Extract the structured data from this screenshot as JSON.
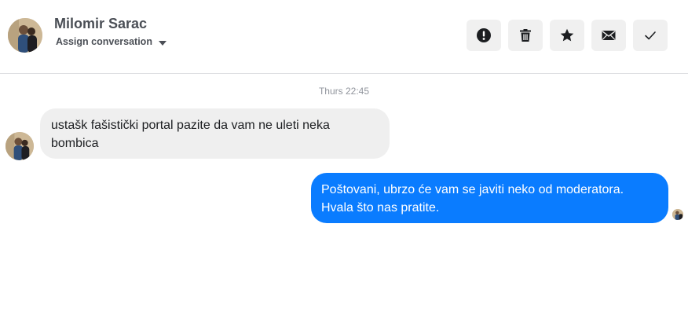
{
  "header": {
    "contact_name": "Milomir Sarac",
    "assign_label": "Assign conversation"
  },
  "actions": [
    {
      "name": "report-button",
      "icon": "exclamation-circle-icon"
    },
    {
      "name": "delete-button",
      "icon": "trash-icon"
    },
    {
      "name": "star-button",
      "icon": "star-icon"
    },
    {
      "name": "mark-unread-button",
      "icon": "envelope-icon"
    },
    {
      "name": "mark-done-button",
      "icon": "checkmark-icon"
    }
  ],
  "conversation": {
    "timestamp": "Thurs 22:45",
    "messages": [
      {
        "direction": "incoming",
        "text": "ustašk fašistički portal pazite da vam ne uleti neka bombica"
      },
      {
        "direction": "outgoing",
        "text": "Poštovani, ubrzo će vam se javiti neko od moderatora. Hvala što nas pratite."
      }
    ]
  },
  "colors": {
    "outgoing_bubble": "#0a7cff",
    "incoming_bubble": "#efefef",
    "action_button_bg": "#f0f0f0"
  }
}
